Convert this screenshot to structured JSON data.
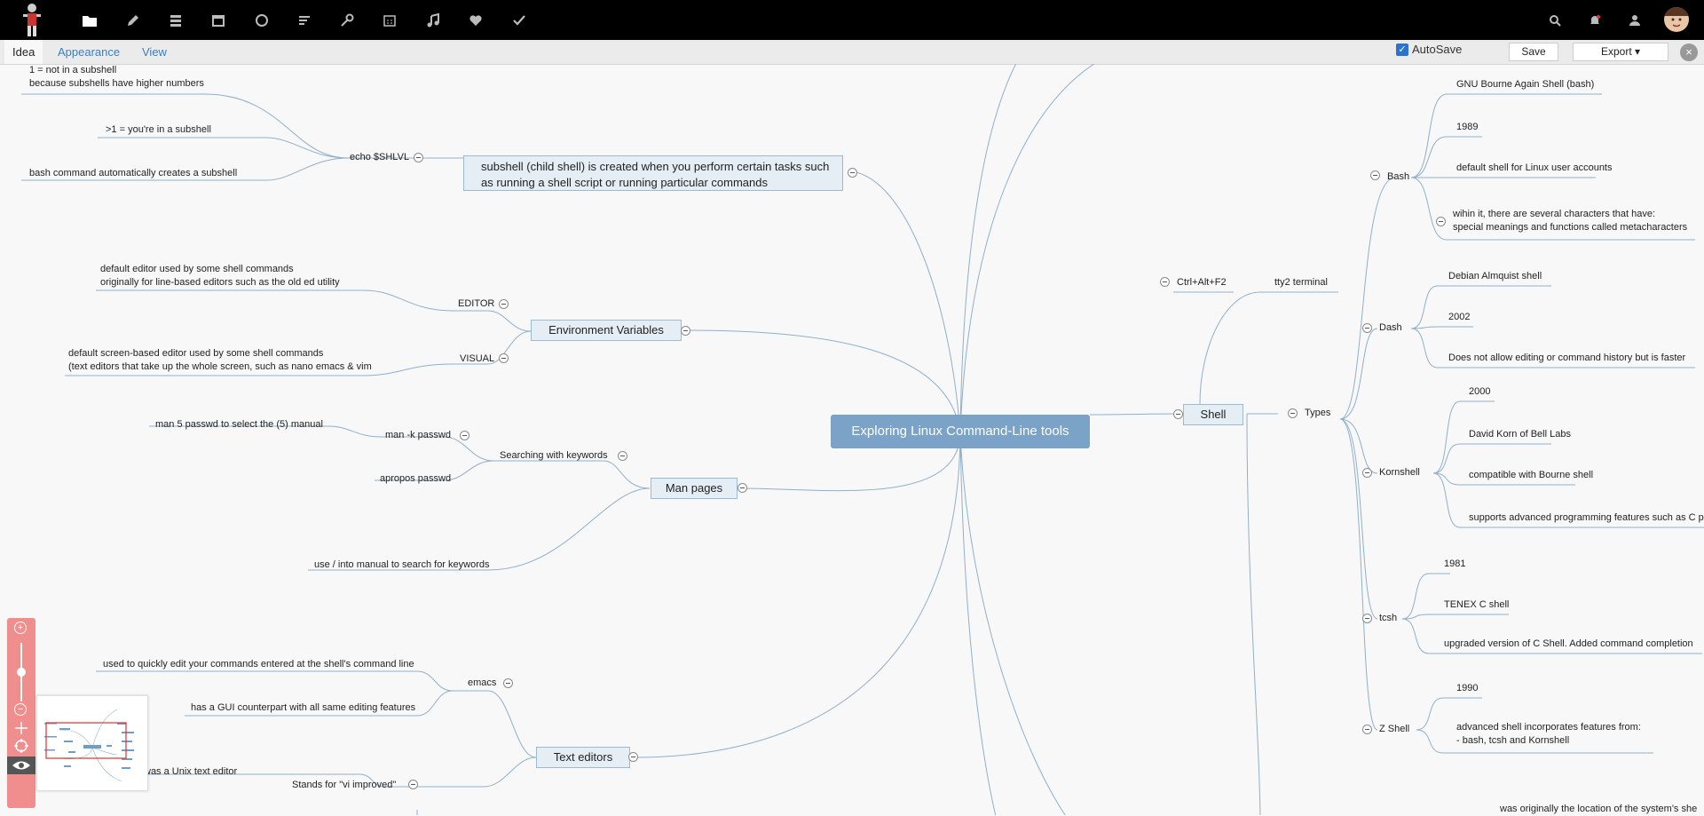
{
  "toolbar": {
    "icons": [
      "avatar-logo",
      "folder-icon",
      "pencil-icon",
      "layers-icon",
      "calendar-icon",
      "chat-icon",
      "list-icon",
      "key-icon",
      "calendar-alt-icon",
      "music-icon",
      "heart-icon",
      "check-icon"
    ],
    "right_icons": [
      "search-icon",
      "notifications-icon",
      "user-icon",
      "profile-avatar"
    ]
  },
  "tabs": {
    "idea": "Idea",
    "appearance": "Appearance",
    "view": "View"
  },
  "actions": {
    "autosave": "AutoSave",
    "save": "Save",
    "export": "Export ▾",
    "close": "×"
  },
  "mindmap": {
    "central": "Exploring Linux Command-Line tools",
    "subshell": {
      "topic_line1": "subshell (child shell) is created when you perform certain tasks such",
      "topic_line2": "as running a shell script or running particular commands",
      "echo": "echo $SHLVL",
      "n1_line1": "1 = not in a subshell",
      "n1_line2": "because subshells have higher numbers",
      "n2": ">1 =  you're in a subshell",
      "n3": "bash command automatically creates a subshell"
    },
    "env": {
      "topic": "Environment Variables",
      "editor": "EDITOR",
      "editor_line1": "default editor used by some shell commands",
      "editor_line2": "originally for line-based editors such as the old ed utility",
      "visual": "VISUAL",
      "visual_line1": "default screen-based editor used by some shell commands",
      "visual_line2": "(text editors that take up the whole screen, such as nano emacs & vim"
    },
    "man": {
      "topic": "Man pages",
      "searching": "Searching with keywords",
      "mank": "man -k passwd",
      "man5": "man 5 passwd to select the (5) manual",
      "apropos": "apropos passwd",
      "use": "use / into manual to search for keywords"
    },
    "editors": {
      "topic": "Text editors",
      "emacs": "emacs",
      "emacs1": "used to quickly edit your commands entered at the shell's command line",
      "emacs2": "has a GUI counterpart with all same editing features",
      "vi": "Stands for \"vi improved\"",
      "vi_note": "was a Unix text editor"
    },
    "shell": {
      "topic": "Shell",
      "tty": "tty2 terminal",
      "ctrl": "Ctrl+Alt+F2",
      "types": "Types",
      "bash": "Bash",
      "bash1": "GNU Bourne Again Shell (bash)",
      "bash2": "1989",
      "bash3": "default shell for Linux user accounts",
      "bash4_line1": "wihin it, there are several characters that have:",
      "bash4_line2": "special meanings and functions called metacharacters",
      "dash": "Dash",
      "dash1": "Debian Almquist shell",
      "dash2": "2002",
      "dash3": "Does not allow editing or command history but is faster",
      "korn": "Kornshell",
      "korn1": "2000",
      "korn2": "David Korn of Bell Labs",
      "korn3": "compatible with Bourne shell",
      "korn4": "supports advanced programming features such as C p",
      "tcsh": "tcsh",
      "tcsh1": "1981",
      "tcsh2": "TENEX C shell",
      "tcsh3": "upgraded version of C Shell. Added command completion",
      "zsh": "Z Shell",
      "zsh1": "1990",
      "zsh2_line1": "advanced shell incorporates features from:",
      "zsh2_line2": "- bash, tcsh and Kornshell",
      "bottom": "was originally the location of the system's she"
    }
  },
  "colors": {
    "connector": "#8fb0c9",
    "central": "#7aa3c7",
    "box_fill": "#e5eef5",
    "box_border": "#9cbbd2",
    "zoom_panel": "#f08d8d",
    "link": "#3b7fc2"
  }
}
